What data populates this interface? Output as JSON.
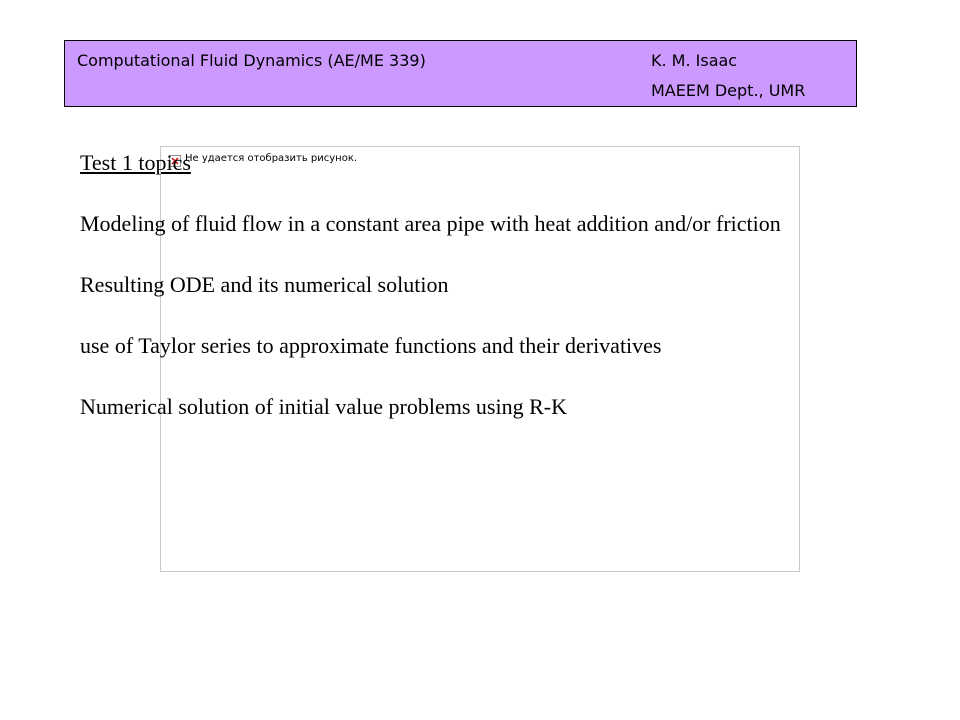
{
  "header": {
    "course": "Computational Fluid Dynamics (AE/ME 339)",
    "author": "K. M. Isaac",
    "department": "MAEEM Dept., UMR",
    "background_color": "#cc99ff"
  },
  "image_placeholder": {
    "icon": "broken-image-icon",
    "message": "Не удается отобразить рисунок."
  },
  "content": {
    "title": "Test 1 topics",
    "topics": [
      "Modeling of fluid flow in a constant area pipe with heat addition and/or friction",
      "Resulting ODE and its numerical solution",
      "use of Taylor series to approximate functions and their derivatives",
      "Numerical solution of initial value problems using R-K"
    ]
  }
}
